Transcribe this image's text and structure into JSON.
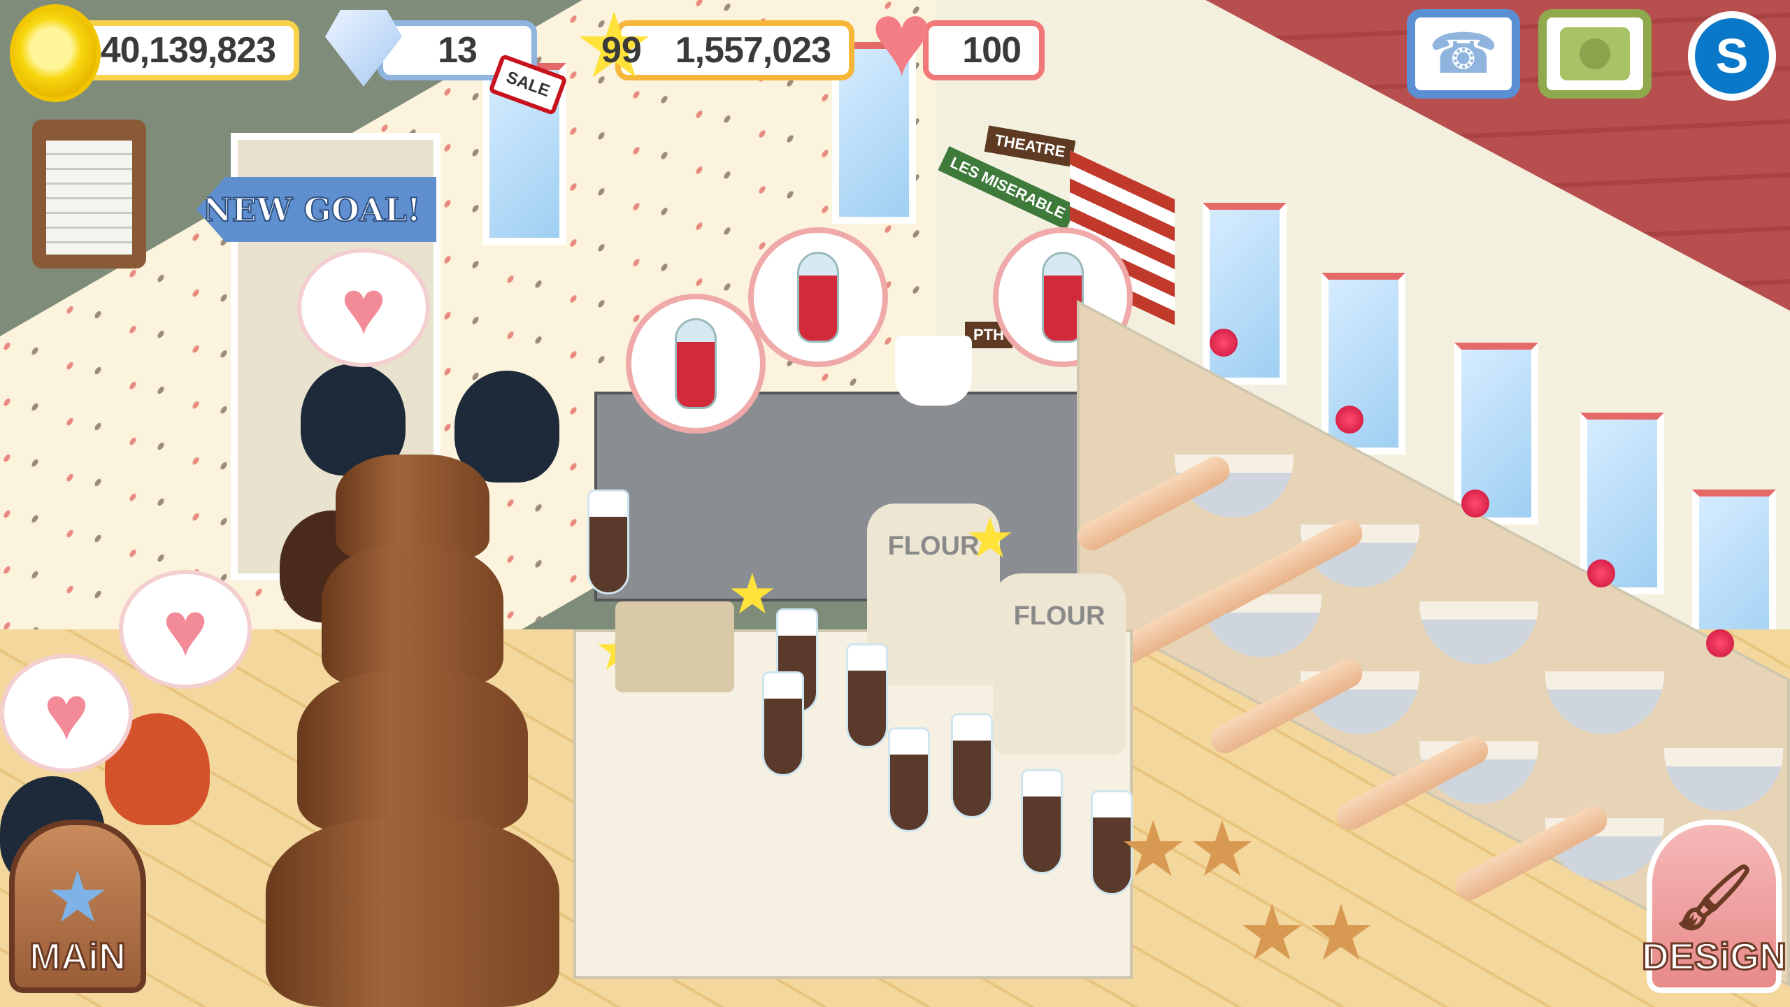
{
  "hud": {
    "coins": "40,139,823",
    "gems": "13",
    "sale_tag": "SALE",
    "level": "99",
    "xp": "1,557,023",
    "hearts": "100"
  },
  "top_buttons": {
    "phone_icon": "phone-icon",
    "camera_icon": "camera-icon",
    "social_icon": "s-icon"
  },
  "goal": {
    "label": "NEW GOAL!"
  },
  "bottom": {
    "main_label": "MAiN",
    "design_label": "DESiGN"
  },
  "scene": {
    "signs": [
      "THEATRE",
      "LES MISERABLE",
      "PTH"
    ],
    "flour_label": "FLOUR"
  },
  "colors": {
    "coin": "#f7d70f",
    "gem": "#8fb4de",
    "xp": "#f6b63a",
    "heart": "#f07878",
    "phone": "#5b8fd4",
    "camera": "#8fa94c",
    "social": "#0a78c8"
  }
}
